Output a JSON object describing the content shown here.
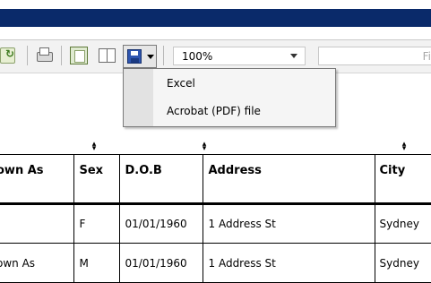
{
  "toolbar": {
    "icons": [
      "refresh-icon",
      "print-icon",
      "page-setup-icon",
      "two-page-icon",
      "save-floppy-icon"
    ],
    "zoom": "100%",
    "find_placeholder": "Fi"
  },
  "export_menu": {
    "items": [
      "Excel",
      "Acrobat (PDF) file"
    ]
  },
  "table": {
    "sort_indicator": "▴▾",
    "columns": [
      "own As",
      "Sex",
      "D.O.B",
      "Address",
      "City"
    ],
    "rows": [
      [
        "",
        "F",
        "01/01/1960",
        "1 Address St",
        "Sydney"
      ],
      [
        "own As",
        "M",
        "01/01/1960",
        "1 Address St",
        "Sydney"
      ]
    ]
  },
  "colors": {
    "title_band": "#0a2a6a",
    "toolbar_bg": "#f2f2f2",
    "menu_bg": "#f5f5f5"
  }
}
